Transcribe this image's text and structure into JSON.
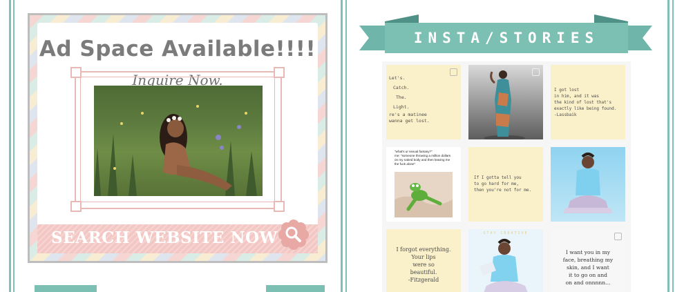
{
  "ad": {
    "title": "Ad Space Available!!!!",
    "subtitle": "Inquire Now.",
    "cta": "SEARCH WEBSITE NOW"
  },
  "insta": {
    "title": "INSTA/STORIES",
    "posts": [
      {
        "lines": [
          "Let's.",
          "Catch.",
          "The.",
          "Light.",
          "re's a matinee",
          "wanna get lost."
        ]
      },
      {
        "lines": []
      },
      {
        "lines": [
          "I got lost",
          "in him, and it was",
          "the kind of lost that's",
          "exactly like being found.",
          "-Lassbaik"
        ]
      },
      {
        "lines": [
          "\"what's ur sexual fantasy?\"",
          "me: \"someone throwing a million dollars",
          "on my naked body and then leaving me",
          "the fuck alone\""
        ]
      },
      {
        "lines": [
          "If I gotta tell you",
          "to go hard for me,",
          "then you're not for me."
        ]
      },
      {
        "lines": []
      },
      {
        "lines": [
          "I forgot everything.",
          "Your lips",
          "were so",
          "beautiful.",
          "-Fitzgerald"
        ]
      },
      {
        "lines": [
          "STAY CREATIVE"
        ]
      },
      {
        "lines": [
          "I want you in my",
          "face, breathing my",
          "skin, and I want",
          "it to go on and",
          "on and onnnnn..."
        ]
      }
    ]
  },
  "colors": {
    "teal": "#7cc0b4",
    "cream": "#faf0c9",
    "pink": "#f3c7c4"
  }
}
